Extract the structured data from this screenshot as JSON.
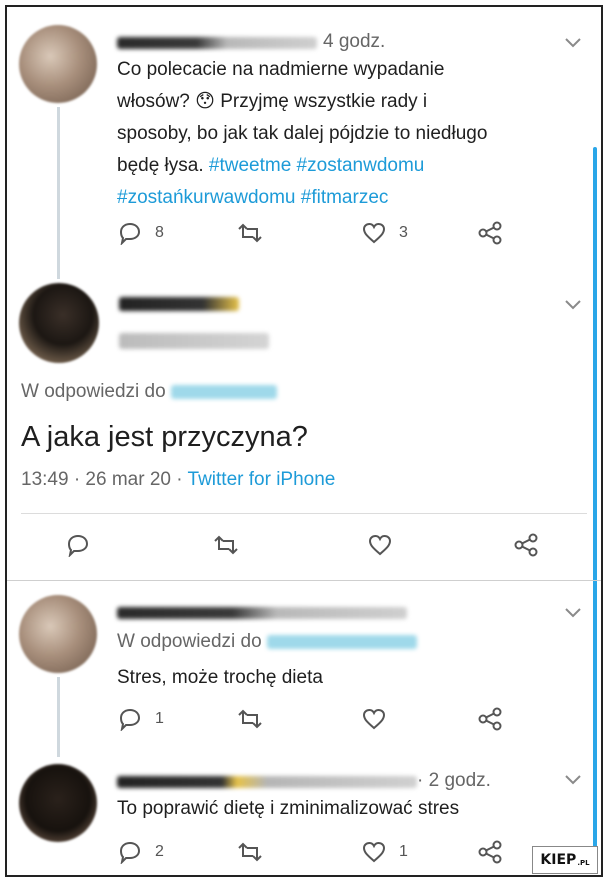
{
  "colors": {
    "accent": "#1d9bd8",
    "text": "#1f1f1f",
    "muted": "#666666",
    "scrollbar": "#2aa6e8"
  },
  "tweet1": {
    "time": "4 godz.",
    "lines": [
      "Co polecacie na nadmierne wypadanie",
      "włosów? 😯 Przyjmę wszystkie rady i",
      "sposoby, bo jak tak dalej pójdzie to niedługo",
      "będę łysa."
    ],
    "hashtags_line4": "#tweetme #zostanwdomu",
    "hashtags_line5": "#zostańkurwawdomu #fitmarzec",
    "replies": "8",
    "likes": "3"
  },
  "main": {
    "reply_prefix": "W odpowiedzi do",
    "text": "A jaka jest przyczyna?",
    "meta_time": "13:49 · 26 mar 20 ·",
    "client": "Twitter for iPhone"
  },
  "reply1": {
    "reply_prefix": "W odpowiedzi do",
    "text": "Stres, może trochę dieta",
    "replies": "1"
  },
  "reply2": {
    "time": "· 2 godz.",
    "text": "To poprawić dietę i zminimalizować stres",
    "replies": "2",
    "likes": "1"
  },
  "watermark": {
    "brand": "KIEP",
    "suffix": ".PL"
  }
}
